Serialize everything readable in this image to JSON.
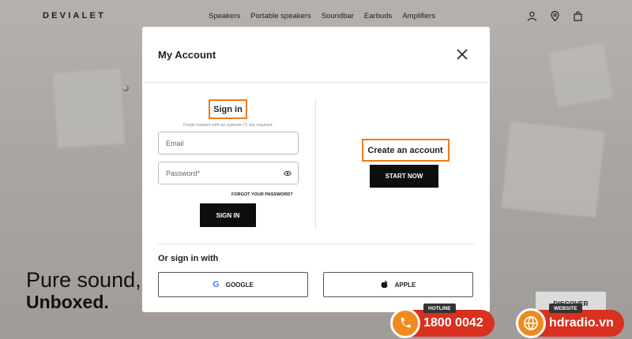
{
  "site": {
    "logo": "DEVIALET",
    "nav": [
      "Speakers",
      "Portable speakers",
      "Soundbar",
      "Earbuds",
      "Amplifiers"
    ],
    "icons": [
      "user-icon",
      "location-pin-icon",
      "bag-icon"
    ],
    "hero_line1": "Pure sound,",
    "hero_line2": "Unboxed.",
    "discover_label": "DISCOVER"
  },
  "modal": {
    "title": "My Account",
    "signin": {
      "heading": "Sign in",
      "note": "Fields marked with an asterisk (*) are required.",
      "email_placeholder": "Email",
      "password_placeholder": "Password*",
      "forgot": "FORGOT YOUR PASSWORD?",
      "button": "SIGN IN"
    },
    "create": {
      "heading": "Create an account",
      "button": "START NOW"
    },
    "social": {
      "heading": "Or sign in with",
      "google": "GOOGLE",
      "apple": "APPLE"
    }
  },
  "watermark": {
    "hotline_tag": "HOTLINE",
    "hotline_number": "1800 0042",
    "website_tag": "WEBSITE",
    "website": "hdradio.vn"
  },
  "colors": {
    "highlight": "#f07a1a",
    "banner_red": "#d9301f",
    "banner_orange": "#f08a1f",
    "button_black": "#0d0d0d"
  }
}
